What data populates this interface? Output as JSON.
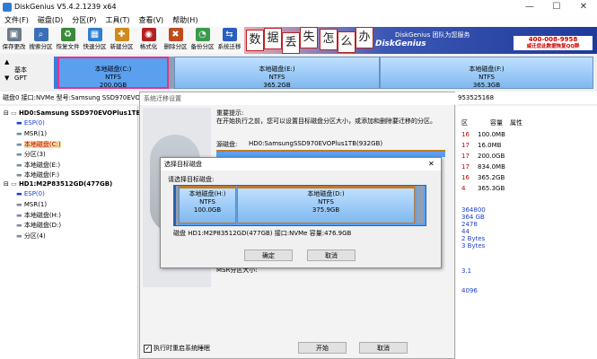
{
  "window": {
    "title": "DiskGenius V5.4.2.1239 x64",
    "min": "—",
    "max": "☐",
    "close": "✕"
  },
  "menu": [
    "文件(F)",
    "磁盘(D)",
    "分区(P)",
    "工具(T)",
    "查看(V)",
    "帮助(H)"
  ],
  "toolbar": [
    {
      "label": "保存更改",
      "icon": "save-icon",
      "color": "#6b7b8c",
      "glyph": "▣"
    },
    {
      "label": "搜索分区",
      "icon": "search-icon",
      "color": "#3b6fb6",
      "glyph": "⌕"
    },
    {
      "label": "恢复文件",
      "icon": "recover-icon",
      "color": "#3a8a3a",
      "glyph": "♻"
    },
    {
      "label": "快速分区",
      "icon": "quick-partition-icon",
      "color": "#2f7fcf",
      "glyph": "▦"
    },
    {
      "label": "新建分区",
      "icon": "new-partition-icon",
      "color": "#d08a1a",
      "glyph": "✚"
    },
    {
      "label": "格式化",
      "icon": "format-icon",
      "color": "#b22222",
      "glyph": "◉"
    },
    {
      "label": "删除分区",
      "icon": "delete-partition-icon",
      "color": "#c04a1a",
      "glyph": "✖"
    },
    {
      "label": "备份分区",
      "icon": "backup-partition-icon",
      "color": "#3a9a4a",
      "glyph": "◔"
    },
    {
      "label": "系统迁移",
      "icon": "system-migration-icon",
      "color": "#2a5fbf",
      "glyph": "⇆"
    }
  ],
  "banner": {
    "chars": [
      "数",
      "据",
      "丢",
      "失",
      "怎",
      "么",
      "办"
    ],
    "promo": "DiskGenius 团队为您服务",
    "brand": "DiskGenius",
    "phone_line1": "400-008-9958",
    "phone_line2": "咸迁您此数据恢复QQ群"
  },
  "diskmap": {
    "gpt_label_1": "基本",
    "gpt_label_2": "GPT",
    "partitions": [
      {
        "name": "本地磁盘(C:)",
        "fs": "NTFS",
        "size": "200.0GB"
      },
      {
        "name": "本地磁盘(E:)",
        "fs": "NTFS",
        "size": "365.2GB"
      },
      {
        "name": "本地磁盘(F:)",
        "fs": "NTFS",
        "size": "365.3GB"
      }
    ]
  },
  "infoline": {
    "text": "磁盘0 接口:NVMe  型号:Samsung SSD970EVOPlus1TB",
    "right": "953525168"
  },
  "tree": [
    {
      "text": "HD0:Samsung SSD970EVOPlus1TB(93",
      "type": "disk"
    },
    {
      "text": "ESP(0)",
      "type": "esp"
    },
    {
      "text": "MSR(1)",
      "type": "msr"
    },
    {
      "text": "本地磁盘(C:)",
      "type": "selected"
    },
    {
      "text": "分区(3)",
      "type": "plain"
    },
    {
      "text": "本地磁盘(E:)",
      "type": "plain"
    },
    {
      "text": "本地磁盘(F:)",
      "type": "plain"
    },
    {
      "text": "HD1:M2P83512GD(477GB)",
      "type": "disk"
    },
    {
      "text": "ESP(0)",
      "type": "esp"
    },
    {
      "text": "MSR(1)",
      "type": "msr"
    },
    {
      "text": "本地磁盘(H:)",
      "type": "plain"
    },
    {
      "text": "本地磁盘(D:)",
      "type": "plain"
    },
    {
      "text": "分区(4)",
      "type": "plain"
    }
  ],
  "righttable": {
    "headers": [
      "区",
      "容量",
      "属性"
    ],
    "rows": [
      {
        "num": "16",
        "size": "100.0MB",
        "attr": ""
      },
      {
        "num": "17",
        "size": "16.0MB",
        "attr": ""
      },
      {
        "num": "17",
        "size": "200.0GB",
        "attr": ""
      },
      {
        "num": "17",
        "size": "834.0MB",
        "attr": ""
      },
      {
        "num": "16",
        "size": "365.2GB",
        "attr": ""
      },
      {
        "num": "4",
        "size": "365.3GB",
        "attr": ""
      }
    ],
    "extra": [
      "364800",
      "364 GB",
      "2478",
      "44",
      "2 Bytes",
      "3 Bytes",
      "3.1",
      "4096"
    ]
  },
  "migration_dialog": {
    "title": "系统迁移设置",
    "important": "重要提示:",
    "desc": "在开始执行之前，您可以设置目标磁盘分区大小，或添加和删除要迁移的分区。",
    "source_label": "源磁盘:",
    "source_disk": "HD0:SamsungSSD970EVOPlus1TB(932GB)",
    "msr_label": "MSR分区大小:",
    "reboot_label": "执行时重启系统睡眠",
    "start_btn": "开始",
    "cancel_btn": "取消"
  },
  "select_dialog": {
    "title": "选择目标磁盘",
    "prompt": "请选择目标磁盘:",
    "close": "✕",
    "partitions": [
      {
        "name": "本地磁盘(H:)",
        "fs": "NTFS",
        "size": "100.0GB"
      },
      {
        "name": "本地磁盘(D:)",
        "fs": "NTFS",
        "size": "375.9GB"
      }
    ],
    "disk_info": "磁盘 HD1:M2P83512GD(477GB)  接口:NVMe  容量:476.9GB",
    "ok_btn": "确定",
    "cancel_btn": "取消"
  }
}
